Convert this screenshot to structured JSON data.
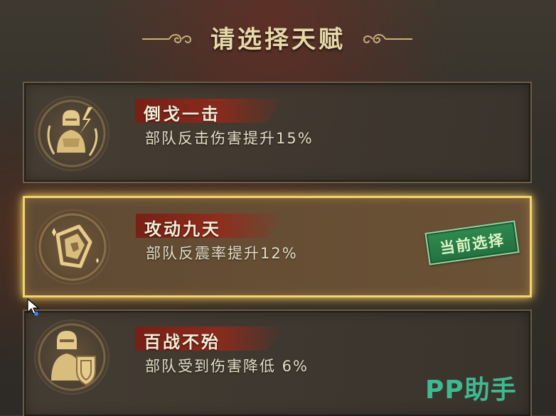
{
  "header": {
    "title": "请选择天赋"
  },
  "talents": [
    {
      "name": "倒戈一击",
      "description": "部队反击伤害提升15%",
      "icon": "warrior-lightning-icon",
      "selected": false
    },
    {
      "name": "攻动九天",
      "description": "部队反震率提升12%",
      "icon": "spiral-shield-icon",
      "selected": true,
      "badge": "当前选择"
    },
    {
      "name": "百战不殆",
      "description": "部队受到伤害降低 6%",
      "icon": "knight-shield-icon",
      "selected": false
    }
  ],
  "watermark": "PP助手",
  "colors": {
    "title": "#e8d8a8",
    "selected_border": "#f3d36a",
    "badge_green": "#2f8a4e",
    "name_tag": "#8a2418",
    "watermark": "#3fb98f"
  }
}
